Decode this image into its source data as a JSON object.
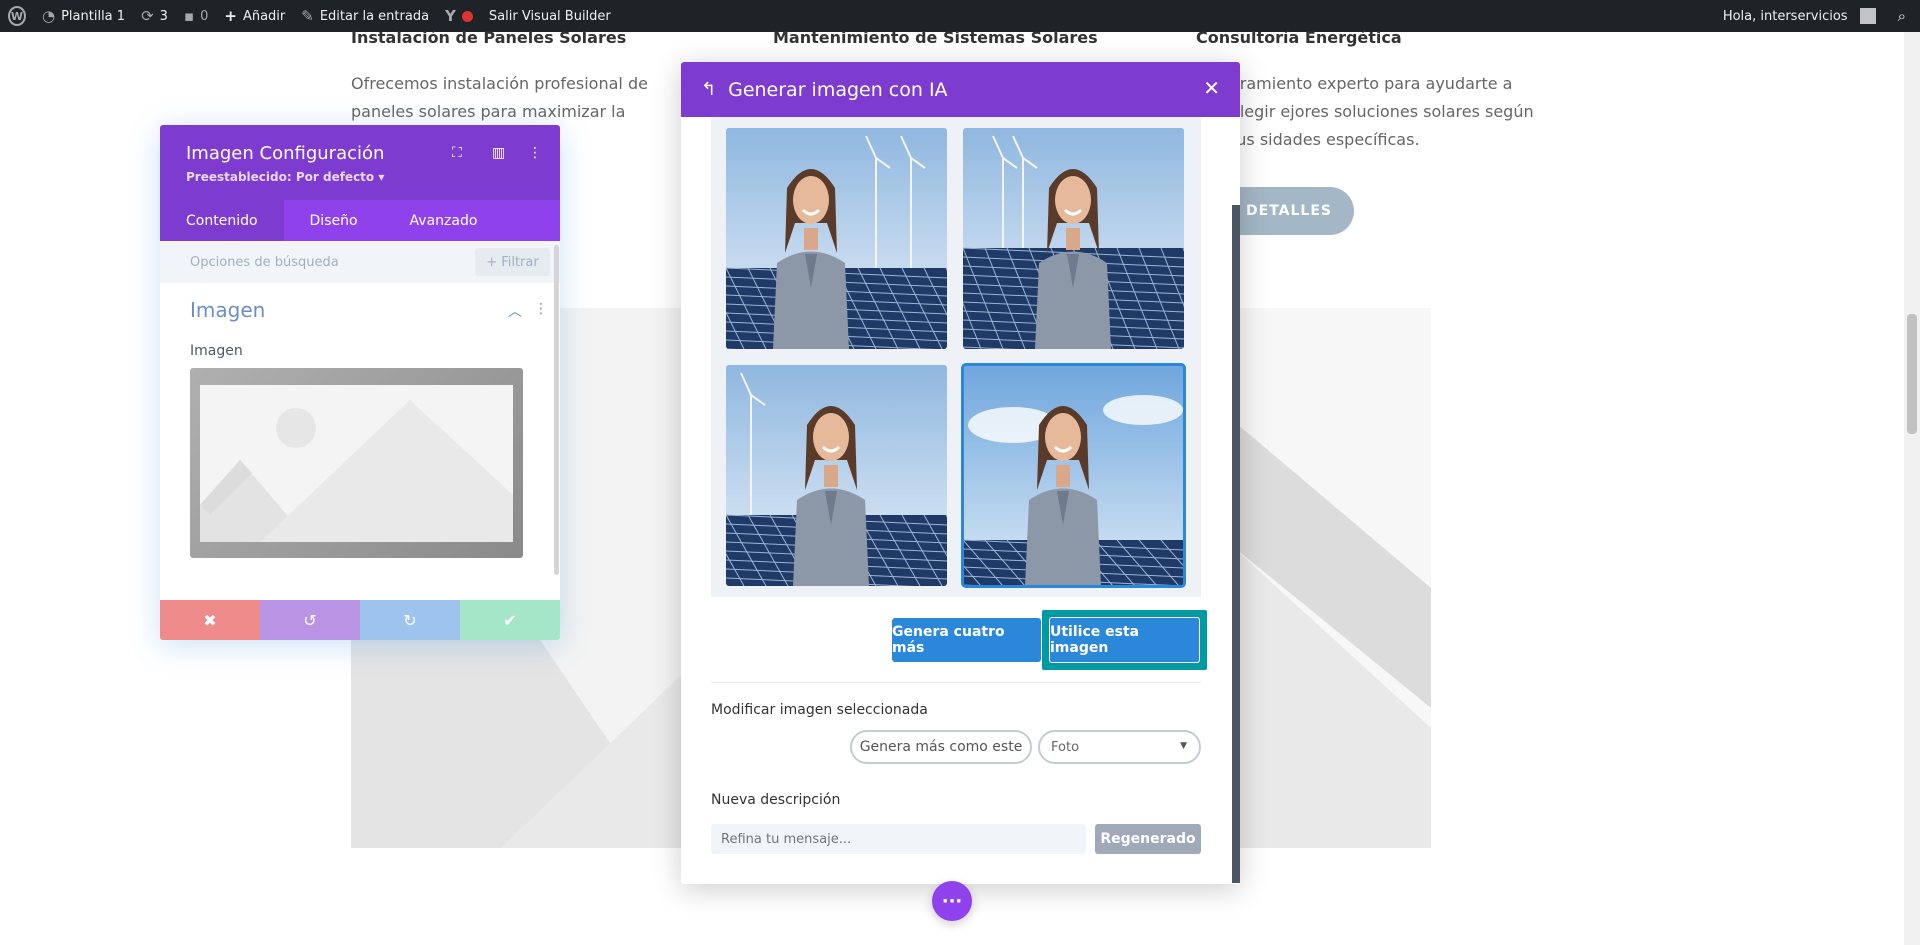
{
  "admin_bar": {
    "site_name": "Plantilla 1",
    "updates_count": "3",
    "comments_count": "0",
    "add_label": "Añadir",
    "edit_label": "Editar la entrada",
    "exit_label": "Salir Visual Builder",
    "greeting": "Hola, interservicios",
    "icons": [
      "wordpress-icon",
      "dashboard-icon",
      "updates-icon",
      "comment-icon",
      "plus-icon",
      "pencil-icon",
      "yoast-icon",
      "status-dot-icon",
      "user-avatar",
      "search-icon"
    ]
  },
  "page": {
    "columns": [
      {
        "title": "Instalación de Paneles Solares",
        "text": "Ofrecemos instalación profesional de paneles solares para maximizar la eficiencia energét"
      },
      {
        "title": "Mantenimiento de Sistemas Solares"
      },
      {
        "title": "Consultoría Energética",
        "text": "oramiento experto para ayudarte a elegir ejores soluciones solares según tus sidades específicas."
      }
    ],
    "details_button": "R DETALLES"
  },
  "settings_panel": {
    "title": "Imagen Configuración",
    "preset": "Preestablecido: Por defecto ▾",
    "tabs": [
      "Contenido",
      "Diseño",
      "Avanzado"
    ],
    "active_tab": "Contenido",
    "search_placeholder": "Opciones de búsqueda",
    "filter_label": "Filtrar",
    "group_title": "Imagen",
    "field_label": "Imagen",
    "colors": {
      "header": "#7e3bd0",
      "tabs": "#8f42ec",
      "cancel": "#ef8a8a",
      "undo": "#b994e4",
      "redo": "#9ec4ee",
      "save": "#a5e6c8"
    }
  },
  "modal": {
    "title": "Generar imagen con IA",
    "generated_images": [
      {
        "name": "generated-image-1",
        "selected": false
      },
      {
        "name": "generated-image-2",
        "selected": false
      },
      {
        "name": "generated-image-3",
        "selected": false
      },
      {
        "name": "generated-image-4",
        "selected": true
      }
    ],
    "generate_more_label": "Genera cuatro más",
    "use_image_label": "Utilice esta imagen",
    "modify_label": "Modificar imagen seleccionada",
    "similar_label": "Genera más como este",
    "style_value": "Foto",
    "new_description_label": "Nueva descripción",
    "refine_placeholder": "Refina tu mensaje...",
    "regenerate_label": "Regenerado",
    "colors": {
      "header": "#7e3bd0",
      "primary": "#2b87da",
      "highlight": "#009aa3"
    }
  }
}
